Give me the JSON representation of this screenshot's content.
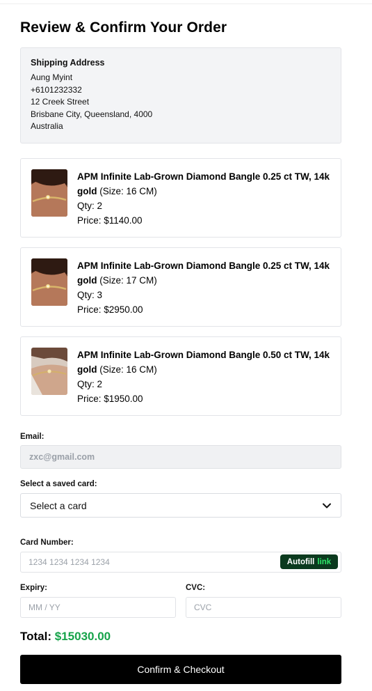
{
  "page": {
    "title": "Review & Confirm Your Order"
  },
  "shipping": {
    "heading": "Shipping Address",
    "lines": [
      "Aung Myint",
      "+6101232332",
      "12 Creek Street",
      "Brisbane City, Queensland, 4000",
      "Australia"
    ]
  },
  "items": [
    {
      "name": "APM Infinite Lab-Grown Diamond Bangle 0.25 ct TW, 14k gold",
      "size": "(Size: 16 CM)",
      "qty": "Qty: 2",
      "price": "Price: $1140.00",
      "image_icon": "bangle-photo-icon"
    },
    {
      "name": "APM Infinite Lab-Grown Diamond Bangle 0.25 ct TW, 14k gold",
      "size": "(Size: 17 CM)",
      "qty": "Qty: 3",
      "price": "Price: $2950.00",
      "image_icon": "bangle-photo-icon"
    },
    {
      "name": "APM Infinite Lab-Grown Diamond Bangle 0.50 ct TW, 14k gold",
      "size": "(Size: 16 CM)",
      "qty": "Qty: 2",
      "price": "Price: $1950.00",
      "image_icon": "bangle-photo-icon"
    }
  ],
  "email": {
    "label": "Email:",
    "value": "zxc@gmail.com"
  },
  "saved_card": {
    "label": "Select a saved card:",
    "selected": "Select a card"
  },
  "card_number": {
    "label": "Card Number:",
    "placeholder": "1234 1234 1234 1234",
    "autofill_text": "Autofill",
    "autofill_link": "link"
  },
  "expiry": {
    "label": "Expiry:",
    "placeholder": "MM / YY"
  },
  "cvc": {
    "label": "CVC:",
    "placeholder": "CVC"
  },
  "total": {
    "label": "Total:",
    "amount": "$15030.00"
  },
  "checkout": {
    "button_label": "Confirm & Checkout"
  },
  "colors": {
    "total_green": "#16a34a",
    "button_bg": "#000000",
    "autofill_bg": "#0b3a1e",
    "link_green": "#2ee86a"
  }
}
